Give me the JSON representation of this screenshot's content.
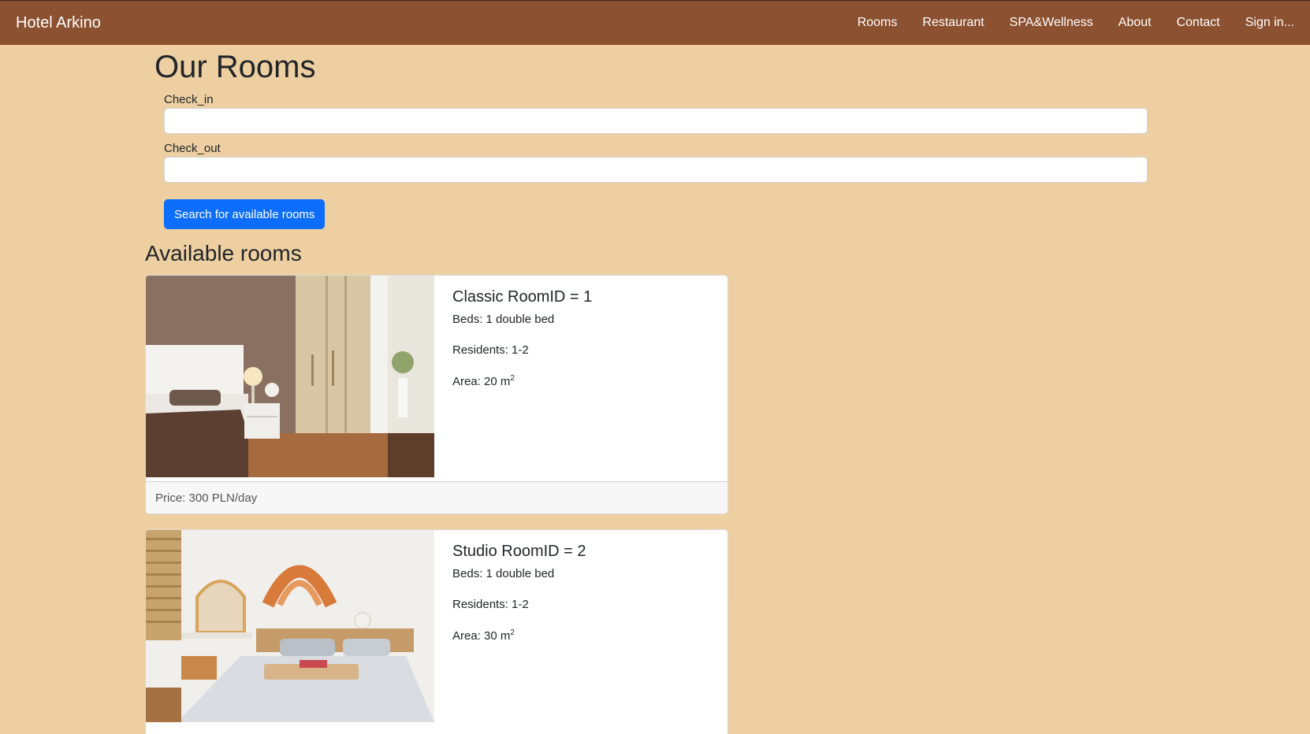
{
  "navbar": {
    "brand": "Hotel Arkino",
    "links": [
      "Rooms",
      "Restaurant",
      "SPA&Wellness",
      "About",
      "Contact",
      "Sign in..."
    ]
  },
  "page": {
    "title": "Our Rooms"
  },
  "form": {
    "check_in_label": "Check_in",
    "check_in_value": "",
    "check_out_label": "Check_out",
    "check_out_value": "",
    "search_button": "Search for available rooms"
  },
  "available": {
    "title": "Available rooms",
    "rooms": [
      {
        "title": "Classic RoomID = 1",
        "beds": "Beds: 1 double bed",
        "residents": "Residents: 1-2",
        "area_prefix": "Area: 20 m",
        "area_sup": "2",
        "price": "Price: 300 PLN/day"
      },
      {
        "title": "Studio RoomID = 2",
        "beds": "Beds: 1 double bed",
        "residents": "Residents: 1-2",
        "area_prefix": "Area: 30 m",
        "area_sup": "2"
      }
    ]
  },
  "colors": {
    "navbar": "#8b5130",
    "background": "#edcfa1",
    "primary_button": "#0d6efd"
  }
}
